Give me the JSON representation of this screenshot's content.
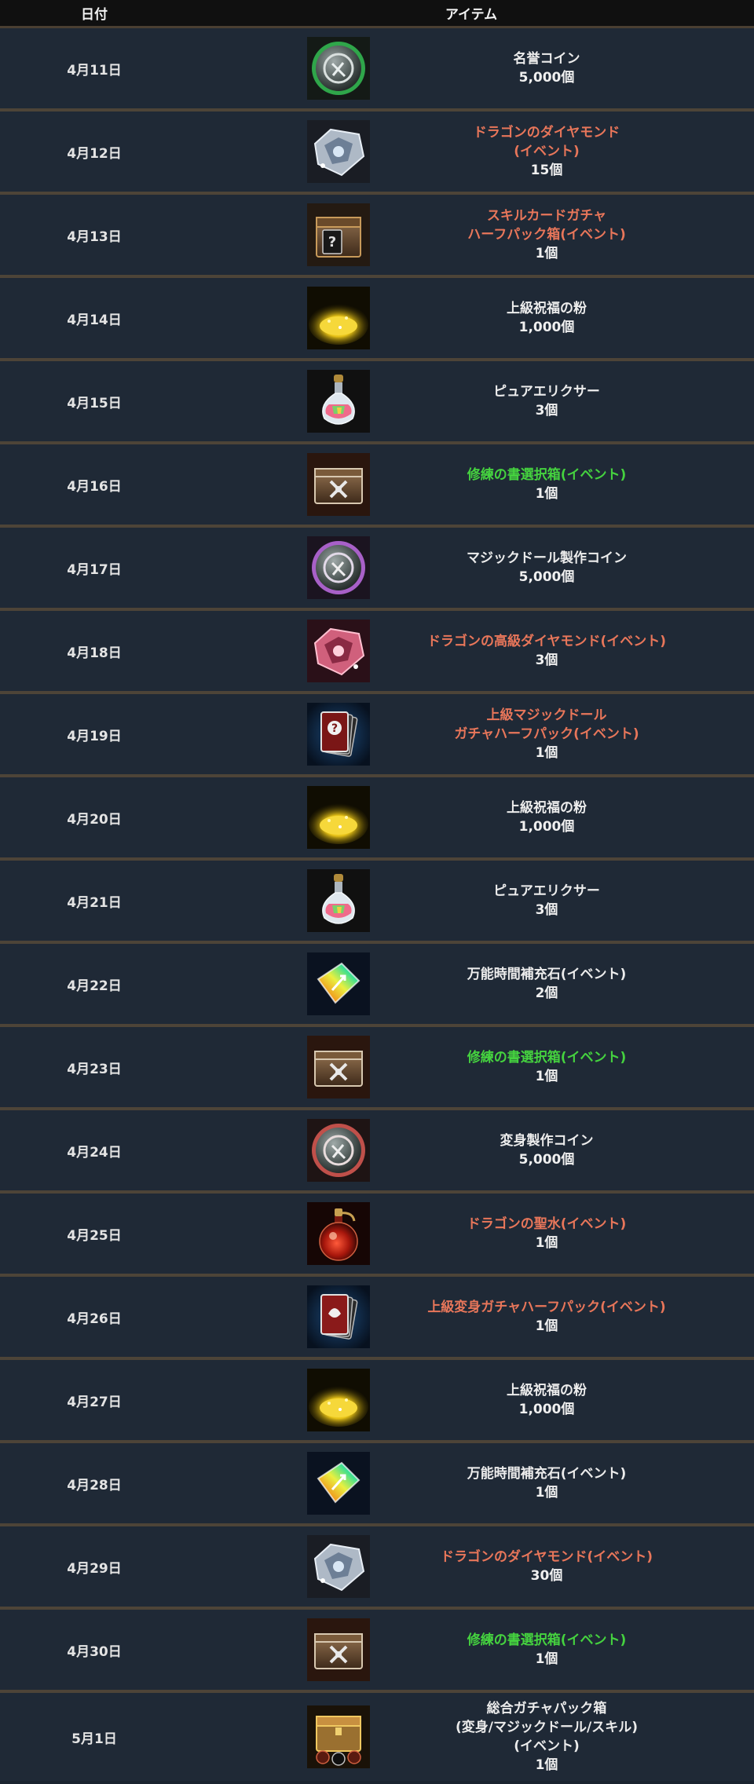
{
  "header": {
    "date_label": "日付",
    "item_label": "アイテム"
  },
  "colors": {
    "normal": "#ececec",
    "event": "#e8765a",
    "green": "#45d23f"
  },
  "rows": [
    {
      "date": "4月11日",
      "icon": "honor-coin-icon",
      "color": "normal",
      "lines": [
        "名誉コイン"
      ],
      "qty": "5,000個"
    },
    {
      "date": "4月12日",
      "icon": "dragon-diamond-icon",
      "color": "event",
      "lines": [
        "ドラゴンのダイヤモンド",
        "(イベント)"
      ],
      "qty": "15個"
    },
    {
      "date": "4月13日",
      "icon": "skill-card-chest-icon",
      "color": "event",
      "lines": [
        "スキルカードガチャ",
        "ハーフパック箱(イベント)"
      ],
      "qty": "1個"
    },
    {
      "date": "4月14日",
      "icon": "gold-powder-icon",
      "color": "normal",
      "lines": [
        "上級祝福の粉"
      ],
      "qty": "1,000個"
    },
    {
      "date": "4月15日",
      "icon": "pure-elixir-icon",
      "color": "normal",
      "lines": [
        "ピュアエリクサー"
      ],
      "qty": "3個"
    },
    {
      "date": "4月16日",
      "icon": "training-book-box-icon",
      "color": "green",
      "lines": [
        "修練の書選択箱(イベント)"
      ],
      "qty": "1個"
    },
    {
      "date": "4月17日",
      "icon": "magic-doll-coin-icon",
      "color": "normal",
      "lines": [
        "マジックドール製作コイン"
      ],
      "qty": "5,000個"
    },
    {
      "date": "4月18日",
      "icon": "dragon-high-diamond-icon",
      "color": "event",
      "lines": [
        "ドラゴンの高級ダイヤモンド(イベント)"
      ],
      "qty": "3個"
    },
    {
      "date": "4月19日",
      "icon": "magic-doll-card-pack-icon",
      "color": "event",
      "lines": [
        "上級マジックドール",
        "ガチャハーフパック(イベント)"
      ],
      "qty": "1個"
    },
    {
      "date": "4月20日",
      "icon": "gold-powder-icon",
      "color": "normal",
      "lines": [
        "上級祝福の粉"
      ],
      "qty": "1,000個"
    },
    {
      "date": "4月21日",
      "icon": "pure-elixir-icon",
      "color": "normal",
      "lines": [
        "ピュアエリクサー"
      ],
      "qty": "3個"
    },
    {
      "date": "4月22日",
      "icon": "rainbow-time-stone-icon",
      "color": "normal",
      "lines": [
        "万能時間補充石(イベント)"
      ],
      "qty": "2個"
    },
    {
      "date": "4月23日",
      "icon": "training-book-box-icon",
      "color": "green",
      "lines": [
        "修練の書選択箱(イベント)"
      ],
      "qty": "1個"
    },
    {
      "date": "4月24日",
      "icon": "transform-coin-icon",
      "color": "normal",
      "lines": [
        "変身製作コイン"
      ],
      "qty": "5,000個"
    },
    {
      "date": "4月25日",
      "icon": "dragon-holy-water-icon",
      "color": "event",
      "lines": [
        "ドラゴンの聖水(イベント)"
      ],
      "qty": "1個"
    },
    {
      "date": "4月26日",
      "icon": "transform-card-pack-icon",
      "color": "event",
      "lines": [
        "上級変身ガチャハーフパック(イベント)"
      ],
      "qty": "1個"
    },
    {
      "date": "4月27日",
      "icon": "gold-powder-icon",
      "color": "normal",
      "lines": [
        "上級祝福の粉"
      ],
      "qty": "1,000個"
    },
    {
      "date": "4月28日",
      "icon": "rainbow-time-stone-icon",
      "color": "normal",
      "lines": [
        "万能時間補充石(イベント)"
      ],
      "qty": "1個"
    },
    {
      "date": "4月29日",
      "icon": "dragon-diamond-icon",
      "color": "event",
      "lines": [
        "ドラゴンのダイヤモンド(イベント)"
      ],
      "qty": "30個"
    },
    {
      "date": "4月30日",
      "icon": "training-book-box-icon",
      "color": "green",
      "lines": [
        "修練の書選択箱(イベント)"
      ],
      "qty": "1個"
    },
    {
      "date": "5月1日",
      "icon": "gacha-pack-chest-icon",
      "color": "normal",
      "lines": [
        "総合ガチャパック箱",
        "(変身/マジックドール/スキル)",
        "(イベント)"
      ],
      "qty": "1個"
    }
  ]
}
